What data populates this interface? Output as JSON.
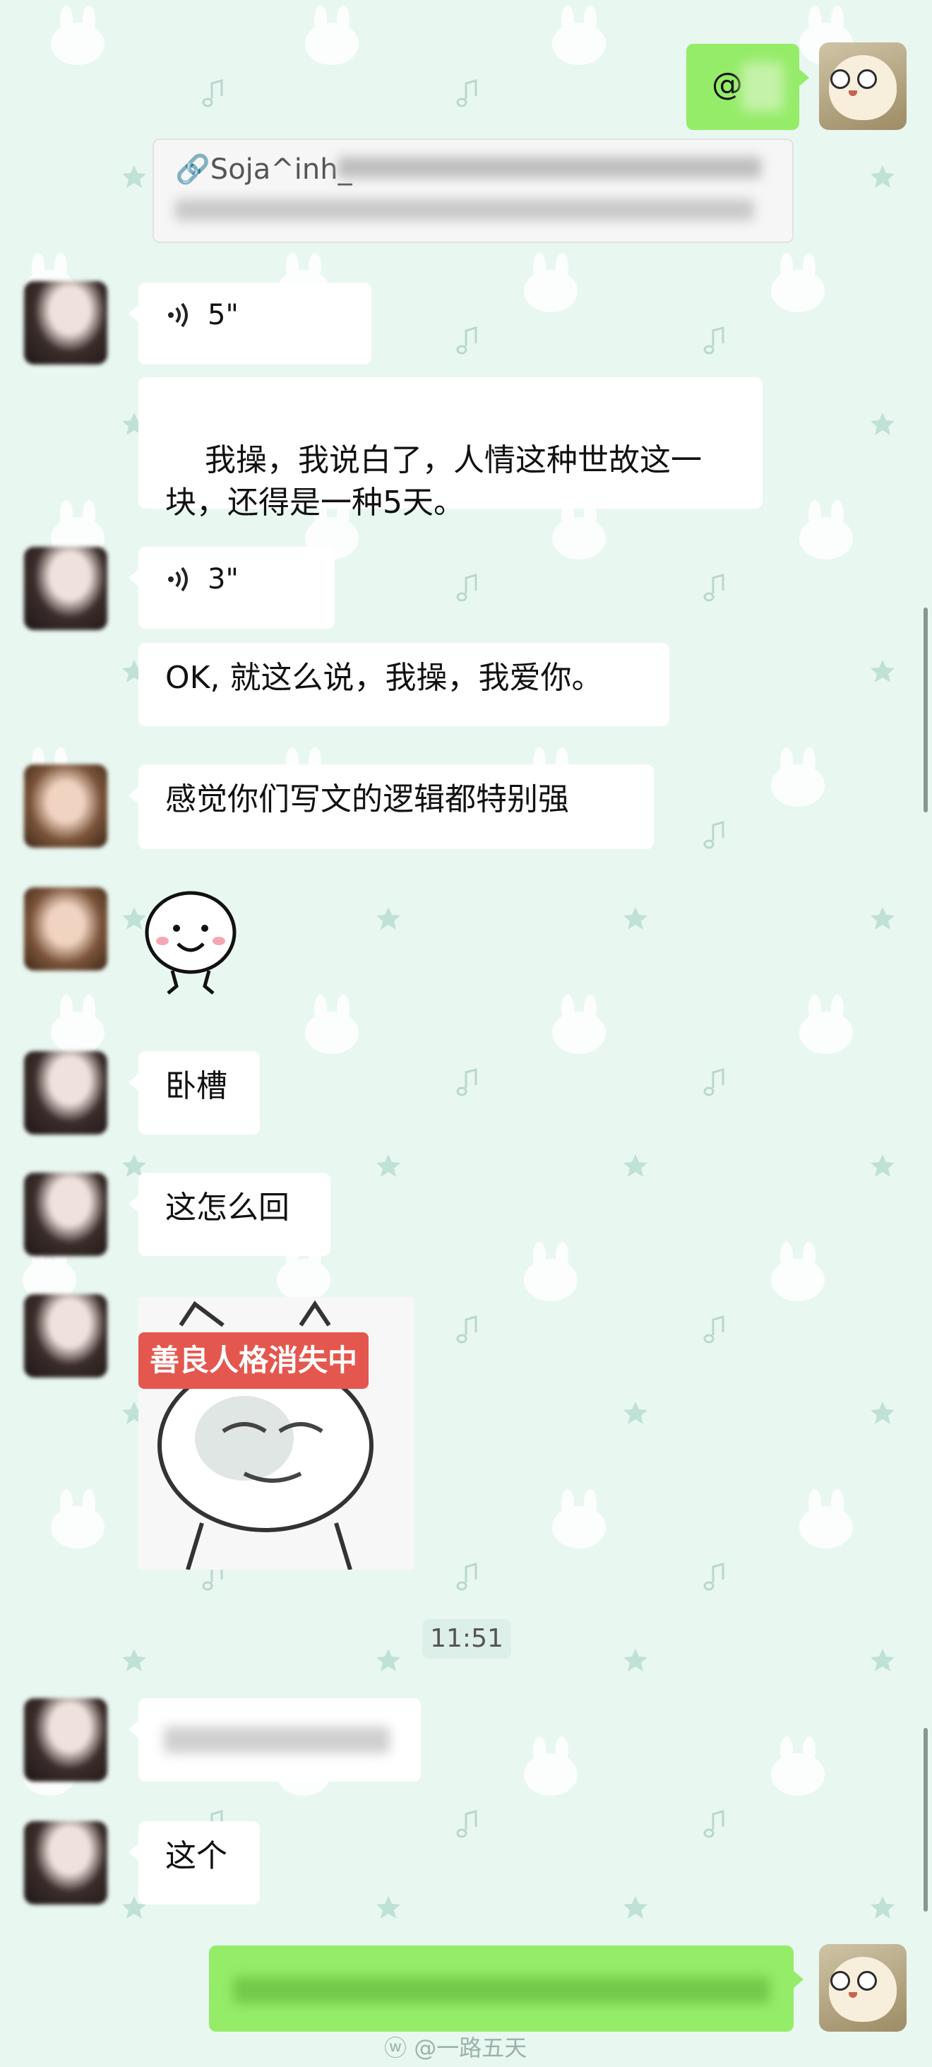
{
  "messages": {
    "top_mention": "@",
    "link_card_title": "🔗Soja^inh_",
    "voice1_duration": "5\"",
    "text1": "我操，我说白了，人情这种世故这一\n块，还得是一种5天。",
    "voice2_duration": "3\"",
    "text2": "OK, 就这么说，我操，我爱你。",
    "text3": "感觉你们写文的逻辑都特别强",
    "text4": "卧槽",
    "text5": "这怎么回",
    "sticker_caption": "善良人格消失中",
    "text6": "这个"
  },
  "timestamp": "11:51",
  "watermark": "@一路五天",
  "colors": {
    "background": "#e9f7f1",
    "incoming_bubble": "#ffffff",
    "outgoing_bubble": "#95ec69",
    "sticker_badge": "#e4574f"
  },
  "icons": [
    "voice-icon",
    "smiley-sticker",
    "meme-sticker",
    "link-icon",
    "weibo-icon"
  ]
}
